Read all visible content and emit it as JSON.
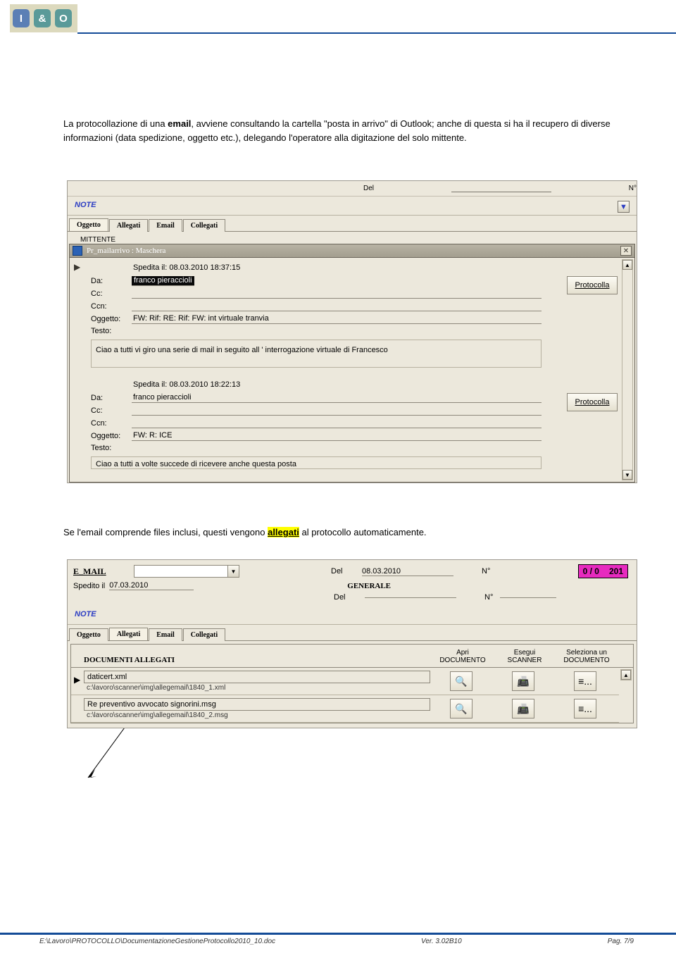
{
  "header": {
    "logo_chars": [
      "I",
      "&",
      "O"
    ]
  },
  "para1": {
    "t1": "La protocollazione di una ",
    "bold": "email",
    "t2": ", avviene consultando la cartella \"posta in arrivo\" di Outlook; anche di questa si ha il recupero di diverse informazioni (data spedizione, oggetto etc.), delegando l'operatore alla digitazione del solo mittente."
  },
  "scr1": {
    "top_labels": {
      "del": "Del",
      "num": "N°"
    },
    "note": "NOTE",
    "tabs": [
      "Oggetto",
      "Allegati",
      "Email",
      "Collegati"
    ],
    "selected_tab": 0,
    "mittente_label": "MITTENTE",
    "window_title": "Pr_mailarrivo : Maschera",
    "record1": {
      "spedita": "Spedita il: 08.03.2010 18:37:15",
      "da_label": "Da:",
      "da_value": "franco pieraccioli",
      "cc_label": "Cc:",
      "ccn_label": "Ccn:",
      "oggetto_label": "Oggetto:",
      "oggetto_value": "FW: Rif: RE: Rif: FW: int virtuale tranvia",
      "testo_label": "Testo:",
      "testo_value": "Ciao a tutti vi giro una serie di mail in seguito all ' interrogazione virtuale di Francesco",
      "protocolla": "Protocolla"
    },
    "record2": {
      "spedita": "Spedita il: 08.03.2010 18:22:13",
      "da_label": "Da:",
      "da_value": "franco pieraccioli",
      "cc_label": "Cc:",
      "ccn_label": "Ccn:",
      "oggetto_label": "Oggetto:",
      "oggetto_value": "FW: R: ICE",
      "testo_label": "Testo:",
      "testo_value": "Ciao a tutti a volte succede di ricevere anche questa posta",
      "protocolla": "Protocolla"
    }
  },
  "para2": {
    "t1": "Se l'email comprende files inclusi, questi vengono ",
    "hl": "allegati",
    "t2": " al protocollo automaticamente."
  },
  "scr2": {
    "email_label": "E_MAIL",
    "del_label": "Del",
    "del_value": "08.03.2010",
    "num_label": "N°",
    "pink_left": "0 / 0",
    "pink_right": "201",
    "spedito_label": "Spedito il",
    "spedito_value": "07.03.2010",
    "generale": "GENERALE",
    "del2_label": "Del",
    "num2_label": "N°",
    "note": "NOTE",
    "tabs": [
      "Oggetto",
      "Allegati",
      "Email",
      "Collegati"
    ],
    "selected_tab": 1,
    "doc_heading": "DOCUMENTI ALLEGATI",
    "col_open": "Apri\nDOCUMENTO",
    "col_scan": "Esegui\nSCANNER",
    "col_pick": "Seleziona un\nDOCUMENTO",
    "rows": [
      {
        "name": "daticert.xml",
        "path": "c:\\lavoro\\scanner\\img\\allegemail\\1840_1.xml"
      },
      {
        "name": "Re preventivo avvocato signorini.msg",
        "path": "c:\\lavoro\\scanner\\img\\allegemail\\1840_2.msg"
      }
    ],
    "open_icon": "🔍",
    "scan_icon": "📠",
    "pick_icon": "≡..."
  },
  "footer": {
    "path": "E:\\Lavoro\\PROTOCOLLO\\DocumentazioneGestioneProtocollo2010_10.doc",
    "version": "Ver. 3.02B10",
    "page": "Pag. 7/9"
  }
}
